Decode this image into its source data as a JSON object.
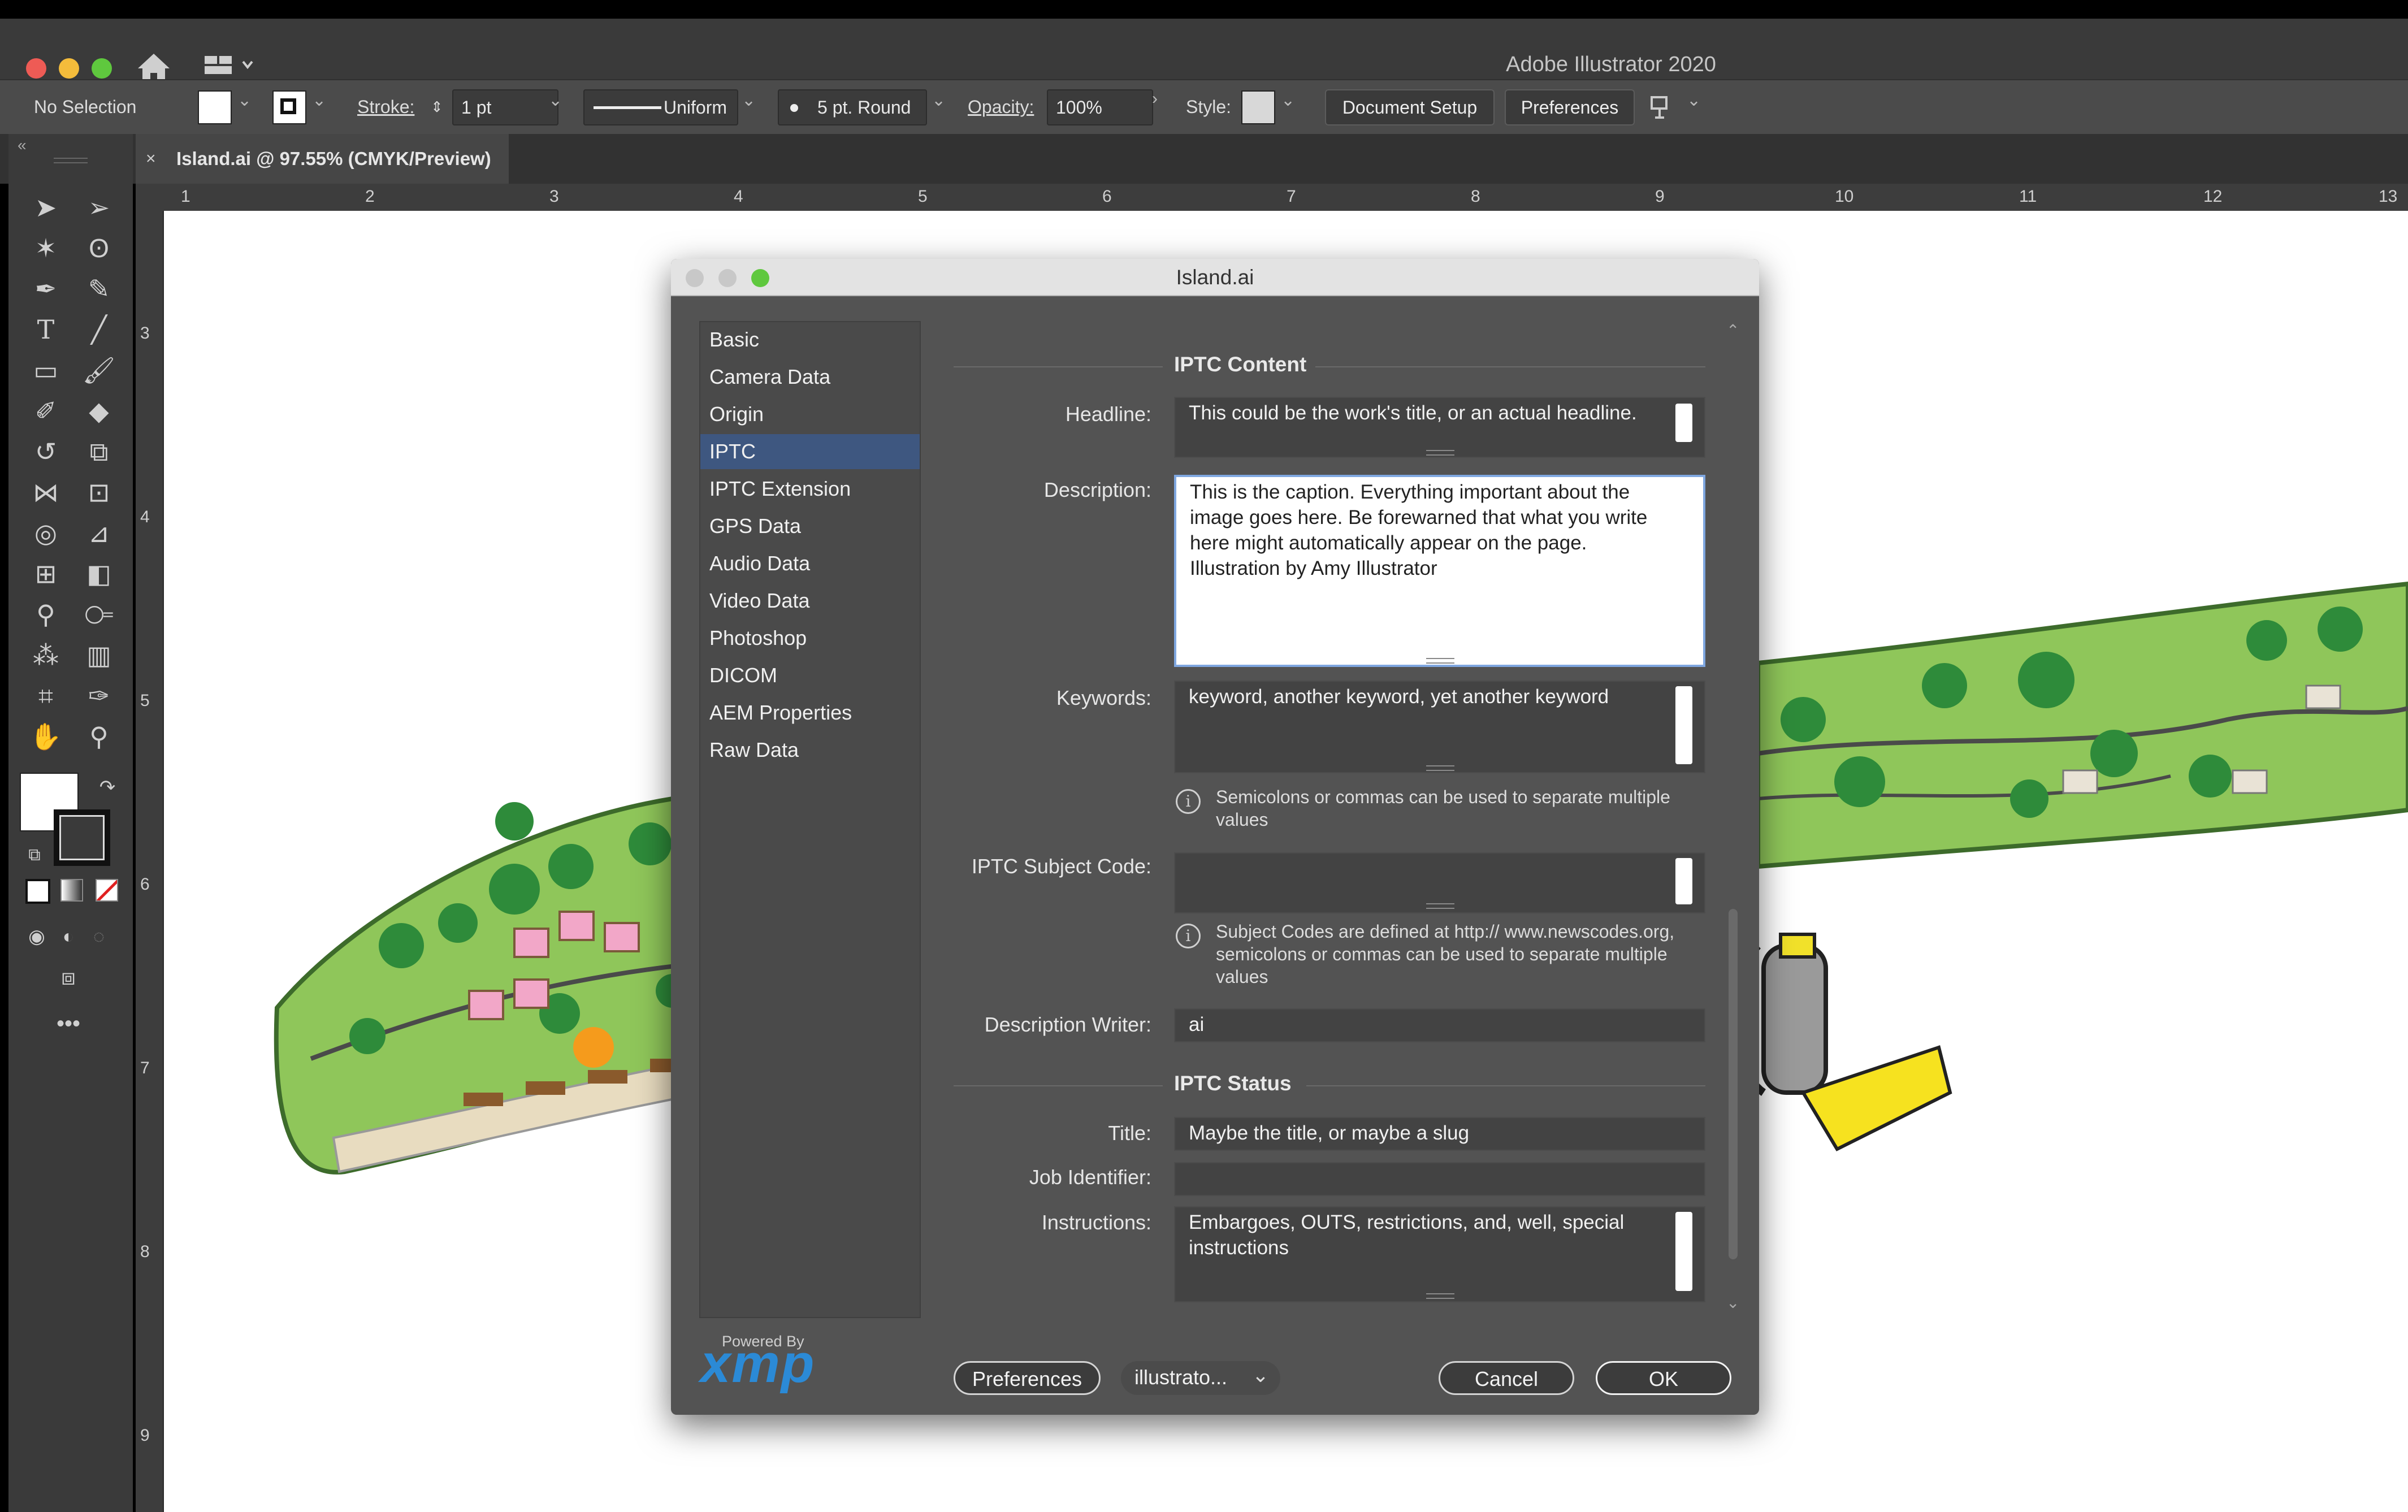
{
  "app": {
    "title": "Adobe Illustrator 2020"
  },
  "controlbar": {
    "selection": "No Selection",
    "stroke_label": "Stroke:",
    "stroke_value": "1 pt",
    "profile": "Uniform",
    "brush": "5 pt. Round",
    "opacity_label": "Opacity:",
    "opacity_value": "100%",
    "style_label": "Style:",
    "document_setup": "Document Setup",
    "preferences": "Preferences"
  },
  "doc_tab": {
    "label": "Island.ai @ 97.55% (CMYK/Preview)",
    "close": "×"
  },
  "ruler": {
    "h": [
      "1",
      "2",
      "3",
      "4",
      "5",
      "6",
      "7",
      "8",
      "9",
      "10",
      "11",
      "12",
      "13"
    ],
    "v": [
      "3",
      "4",
      "5",
      "6",
      "7",
      "8",
      "9"
    ]
  },
  "dialog": {
    "title": "Island.ai",
    "nav": [
      "Basic",
      "Camera Data",
      "Origin",
      "IPTC",
      "IPTC Extension",
      "GPS Data",
      "Audio Data",
      "Video Data",
      "Photoshop",
      "DICOM",
      "AEM Properties",
      "Raw Data"
    ],
    "selected_nav": "IPTC",
    "iptc_content": "IPTC Content",
    "headline_label": "Headline:",
    "headline": "This could be the work's title, or an actual headline.",
    "description_label": "Description:",
    "description": "This is the caption. Everything important about the image goes here.  Be forewarned that what you write here might automatically appear on the page.             Illustration by Amy Illustrator",
    "keywords_label": "Keywords:",
    "keywords": "keyword, another keyword, yet another keyword",
    "keywords_hint": "Semicolons or commas can be used to separate multiple values",
    "subject_label": "IPTC Subject Code:",
    "subject": "",
    "subject_hint": "Subject Codes are defined at http:// www.newscodes.org, semicolons or commas can be used to separate multiple values",
    "writer_label": "Description Writer:",
    "writer": "ai",
    "iptc_status": "IPTC Status",
    "title_label": "Title:",
    "title_value": "Maybe the title, or maybe a slug",
    "job_label": "Job Identifier:",
    "job_value": "",
    "instructions_label": "Instructions:",
    "instructions": "Embargoes, OUTS, restrictions, and, well, special instructions",
    "powered_by": "Powered By",
    "xmp": "xmp",
    "preferences_btn": "Preferences",
    "template_select": "illustrato...",
    "cancel_btn": "Cancel",
    "ok_btn": "OK"
  },
  "colors": {
    "selection": "#3e5780",
    "highlight_ellipse": "#e05a9a",
    "xmp": "#2b8ad6"
  }
}
